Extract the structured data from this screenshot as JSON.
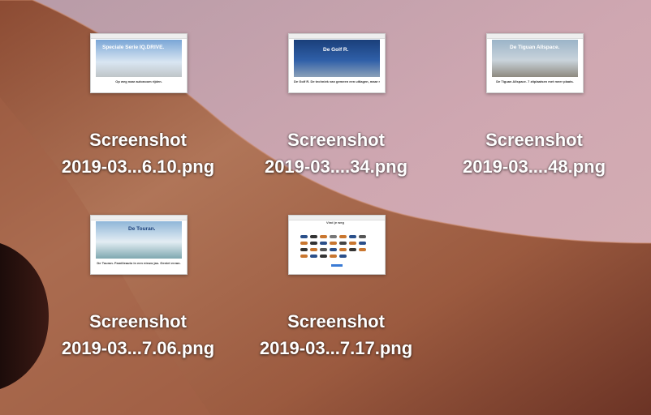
{
  "desktop": {
    "colors": {
      "sky": "#c9a6b0",
      "dune_light": "#a86a4c",
      "dune_dark": "#5a2c1f"
    },
    "files": [
      {
        "line1": "Screenshot",
        "line2": "2019-03...6.10.png",
        "thumb_title": "Speciale Serie IQ.DRIVE.",
        "thumb_caption": "Op weg naar autonoom rijden."
      },
      {
        "line1": "Screenshot",
        "line2": "2019-03....34.png",
        "thumb_title": "De Golf R.",
        "thumb_caption": "De Golf R. De techniek van gemeen een uitlagen, maar niet..."
      },
      {
        "line1": "Screenshot",
        "line2": "2019-03....48.png",
        "thumb_title": "De Tiguan Allspace.",
        "thumb_caption": "De Tiguan Allspace. 7 zitplaatsen met meer plaats."
      },
      {
        "line1": "Screenshot",
        "line2": "2019-03...7.06.png",
        "thumb_title": "De Touran.",
        "thumb_caption": "De Touran. Familieauto in een nieuw jas. Geniet ervan."
      },
      {
        "line1": "Screenshot",
        "line2": "2019-03...7.17.png",
        "thumb_title": "Vind je weg",
        "thumb_caption": ""
      }
    ]
  }
}
